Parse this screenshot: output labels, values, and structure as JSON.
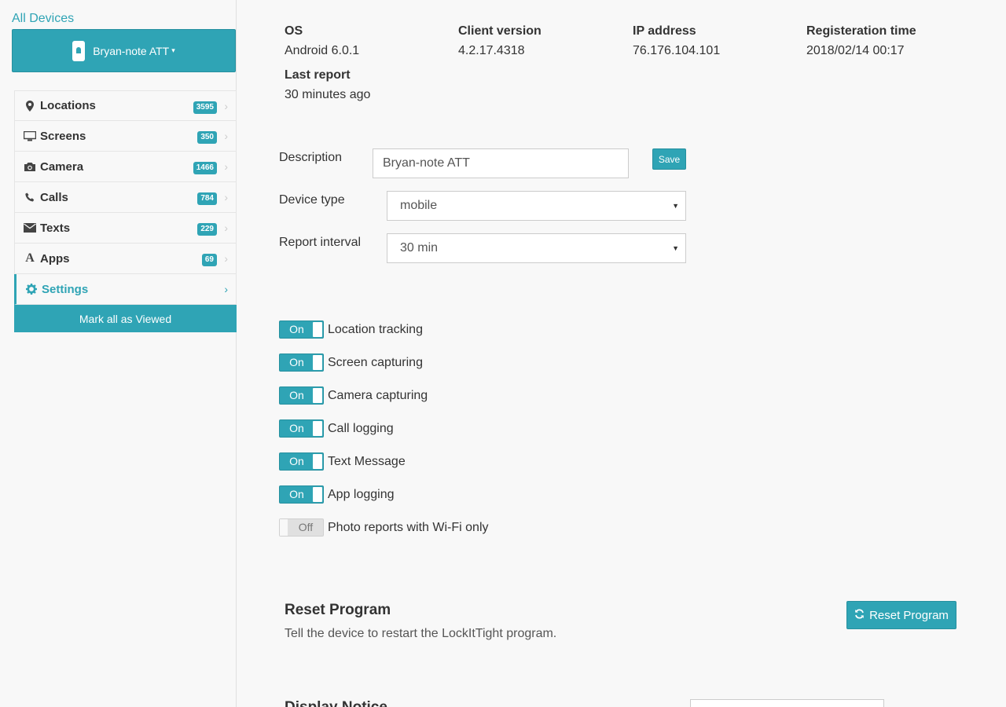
{
  "sidebar": {
    "all_devices": "All Devices",
    "device_name": "Bryan-note ATT",
    "items": [
      {
        "label": "Locations",
        "count": "3595",
        "icon": "map-marker-icon"
      },
      {
        "label": "Screens",
        "count": "350",
        "icon": "monitor-icon"
      },
      {
        "label": "Camera",
        "count": "1466",
        "icon": "camera-icon"
      },
      {
        "label": "Calls",
        "count": "784",
        "icon": "phone-icon"
      },
      {
        "label": "Texts",
        "count": "229",
        "icon": "envelope-icon"
      },
      {
        "label": "Apps",
        "count": "69",
        "icon": "apps-font-icon"
      },
      {
        "label": "Settings",
        "icon": "gear-icon",
        "active": true
      }
    ],
    "mark_all": "Mark all as Viewed"
  },
  "info": {
    "os_label": "OS",
    "os_value": "Android 6.0.1",
    "client_label": "Client version",
    "client_value": "4.2.17.4318",
    "ip_label": "IP address",
    "ip_value": "76.176.104.101",
    "reg_label": "Registeration time",
    "reg_value": "2018/02/14 00:17",
    "last_label": "Last report",
    "last_value": "30 minutes ago"
  },
  "form": {
    "description_label": "Description",
    "description_value": "Bryan-note ATT",
    "save": "Save",
    "device_type_label": "Device type",
    "device_type_value": "mobile",
    "report_interval_label": "Report interval",
    "report_interval_value": "30 min"
  },
  "toggles": [
    {
      "state": "On",
      "label": "Location tracking"
    },
    {
      "state": "On",
      "label": "Screen capturing"
    },
    {
      "state": "On",
      "label": "Camera capturing"
    },
    {
      "state": "On",
      "label": "Call logging"
    },
    {
      "state": "On",
      "label": "Text Message"
    },
    {
      "state": "On",
      "label": "App logging"
    },
    {
      "state": "Off",
      "label": "Photo reports with Wi-Fi only"
    }
  ],
  "reset": {
    "title": "Reset Program",
    "desc": "Tell the device to restart the LockItTight program.",
    "button": "Reset Program"
  },
  "notice": {
    "title": "Display Notice"
  },
  "colors": {
    "accent": "#2fa4b5"
  }
}
